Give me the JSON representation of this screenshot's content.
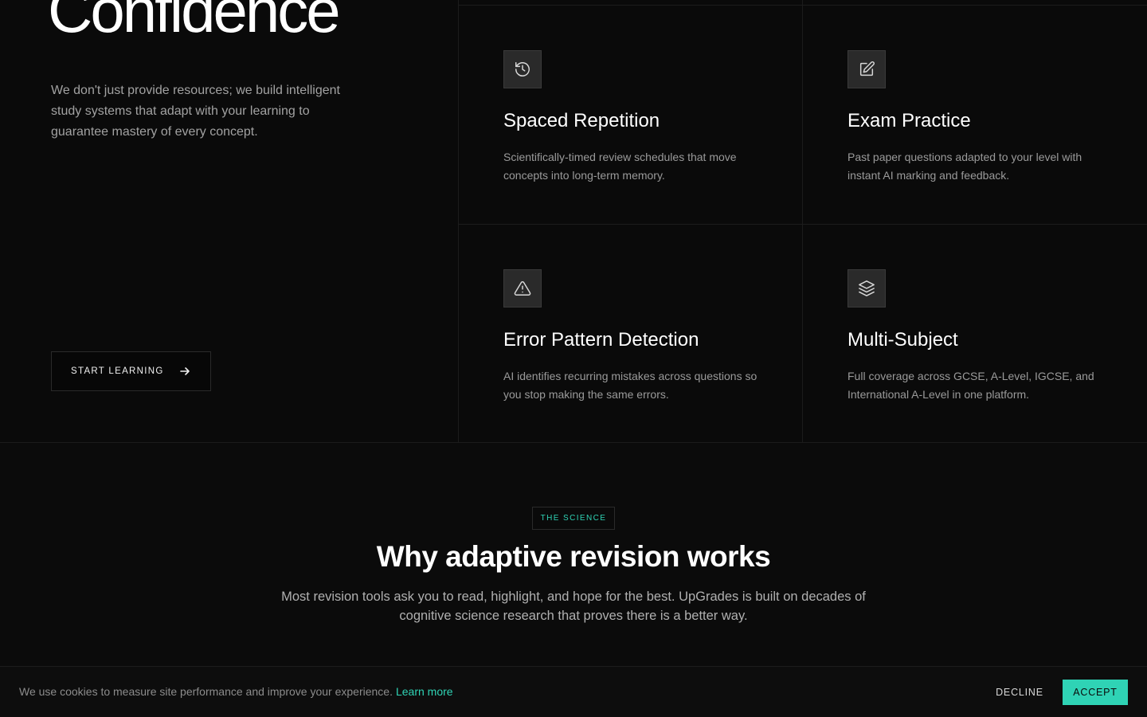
{
  "hero": {
    "title": "Confidence",
    "description": "We don't just provide resources; we build intelligent study systems that adapt with your learning to guarantee mastery of every concept.",
    "cta_label": "START LEARNING"
  },
  "features": [
    {
      "icon": "history-icon",
      "title": "Spaced Repetition",
      "description": "Scientifically-timed review schedules that move concepts into long-term memory."
    },
    {
      "icon": "edit-icon",
      "title": "Exam Practice",
      "description": "Past paper questions adapted to your level with instant AI marking and feedback."
    },
    {
      "icon": "warning-icon",
      "title": "Error Pattern Detection",
      "description": "AI identifies recurring mistakes across questions so you stop making the same errors."
    },
    {
      "icon": "layers-icon",
      "title": "Multi-Subject",
      "description": "Full coverage across GCSE, A-Level, IGCSE, and International A-Level in one platform."
    }
  ],
  "science": {
    "badge": "THE SCIENCE",
    "title": "Why adaptive revision works",
    "description": "Most revision tools ask you to read, highlight, and hope for the best. UpGrades is built on decades of cognitive science research that proves there is a better way."
  },
  "cookie": {
    "text": "We use cookies to measure site performance and improve your experience.",
    "link": "Learn more",
    "decline": "DECLINE",
    "accept": "ACCEPT"
  },
  "colors": {
    "accent": "#2fd3b5",
    "background": "#0b0b0b"
  }
}
